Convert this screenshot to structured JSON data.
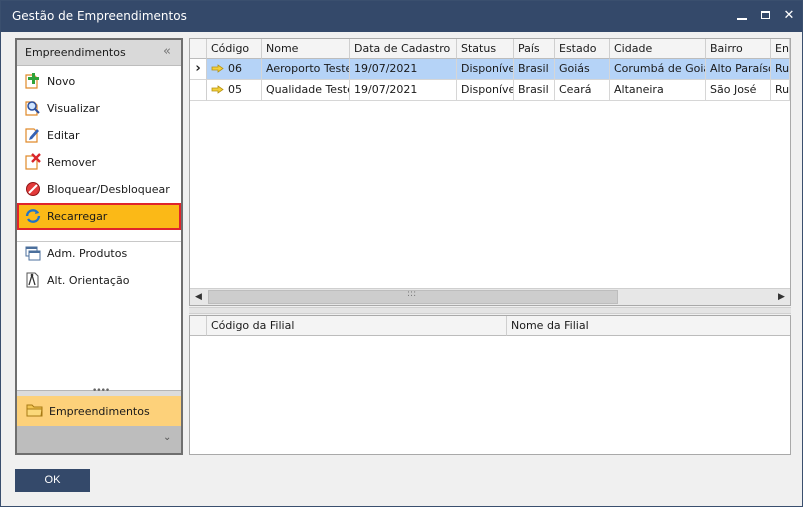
{
  "window": {
    "title": "Gestão de Empreendimentos"
  },
  "leftpanel": {
    "header": "Empreendimentos",
    "collapse_glyph": "«",
    "items": [
      {
        "label": "Novo",
        "icon": "new-plus-icon"
      },
      {
        "label": "Visualizar",
        "icon": "magnifier-icon"
      },
      {
        "label": "Editar",
        "icon": "pencil-icon"
      },
      {
        "label": "Remover",
        "icon": "remove-x-icon"
      },
      {
        "label": "Bloquear/Desbloquear",
        "icon": "block-icon"
      },
      {
        "label": "Recarregar",
        "icon": "reload-icon"
      }
    ],
    "extra_items": [
      {
        "label": "Adm. Produtos",
        "icon": "windows-icon"
      },
      {
        "label": "Alt. Orientação",
        "icon": "compass-doc-icon"
      }
    ],
    "category": "Empreendimentos",
    "footer_glyph": "⌄"
  },
  "grid": {
    "columns": [
      "Código",
      "Nome",
      "Data de Cadastro",
      "Status",
      "País",
      "Estado",
      "Cidade",
      "Bairro",
      "End"
    ],
    "rows": [
      [
        "06",
        "Aeroporto Teste",
        "19/07/2021",
        "Disponível",
        "Brasil",
        "Goiás",
        "Corumbá de Goiás",
        "Alto Paraíso",
        "Rua"
      ],
      [
        "05",
        "Qualidade Teste",
        "19/07/2021",
        "Disponível",
        "Brasil",
        "Ceará",
        "Altaneira",
        "São José",
        "Rua"
      ]
    ],
    "selected_row_marker": "›"
  },
  "subgrid": {
    "columns": [
      "Código da Filial",
      "Nome da Filial"
    ]
  },
  "footer": {
    "ok_label": "OK"
  },
  "colors": {
    "titlebar": "#34496a",
    "highlight": "#fbb917",
    "selection": "#b5d3f7",
    "active_border": "#e0242b"
  }
}
